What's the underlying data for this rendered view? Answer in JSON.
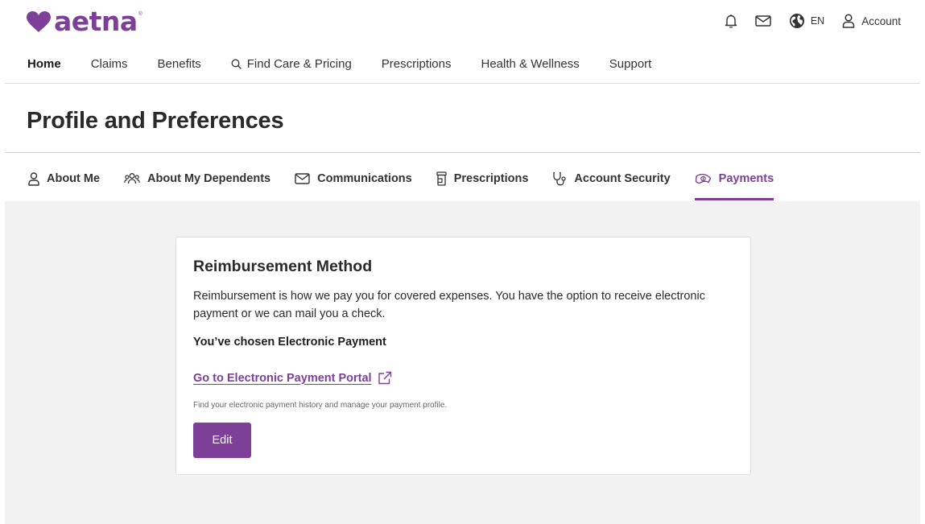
{
  "brand": {
    "logo_text": "aetna",
    "registered_mark": "®",
    "color": "#7d3f98"
  },
  "utility_nav": {
    "items": [
      {
        "icon": "bell-icon"
      },
      {
        "icon": "mail-icon"
      },
      {
        "icon": "globe-icon",
        "label": "EN"
      },
      {
        "icon": "person-icon",
        "label": "Account"
      }
    ]
  },
  "main_nav": {
    "items": [
      {
        "label": "Home",
        "active": true
      },
      {
        "label": "Claims"
      },
      {
        "label": "Benefits"
      },
      {
        "label": "Find Care & Pricing",
        "icon": "search-icon"
      },
      {
        "label": "Prescriptions"
      },
      {
        "label": "Health & Wellness"
      },
      {
        "label": "Support"
      }
    ]
  },
  "page": {
    "title": "Profile and Preferences"
  },
  "sub_tabs": {
    "items": [
      {
        "label": "About Me",
        "icon": "person-icon"
      },
      {
        "label": "About My Dependents",
        "icon": "group-icon"
      },
      {
        "label": "Communications",
        "icon": "mail-icon"
      },
      {
        "label": "Prescriptions",
        "icon": "pill-bottle-icon"
      },
      {
        "label": "Account Security",
        "icon": "shield-icon"
      },
      {
        "label": "Payments",
        "icon": "money-icon",
        "active": true
      }
    ]
  },
  "reimbursement": {
    "title": "Reimbursement Method",
    "description": "Reimbursement is how we pay you for covered expenses. You have the option to receive electronic payment or we can mail you a check.",
    "chosen": "You’ve chosen Electronic Payment",
    "link_label": "Go to Electronic Payment Portal",
    "link_icon": "external-link-icon",
    "note": "Find your electronic payment history and manage your payment profile.",
    "edit_label": "Edit"
  },
  "colors": {
    "accent": "#7d3f98",
    "content_background": "#f2f2f2"
  }
}
